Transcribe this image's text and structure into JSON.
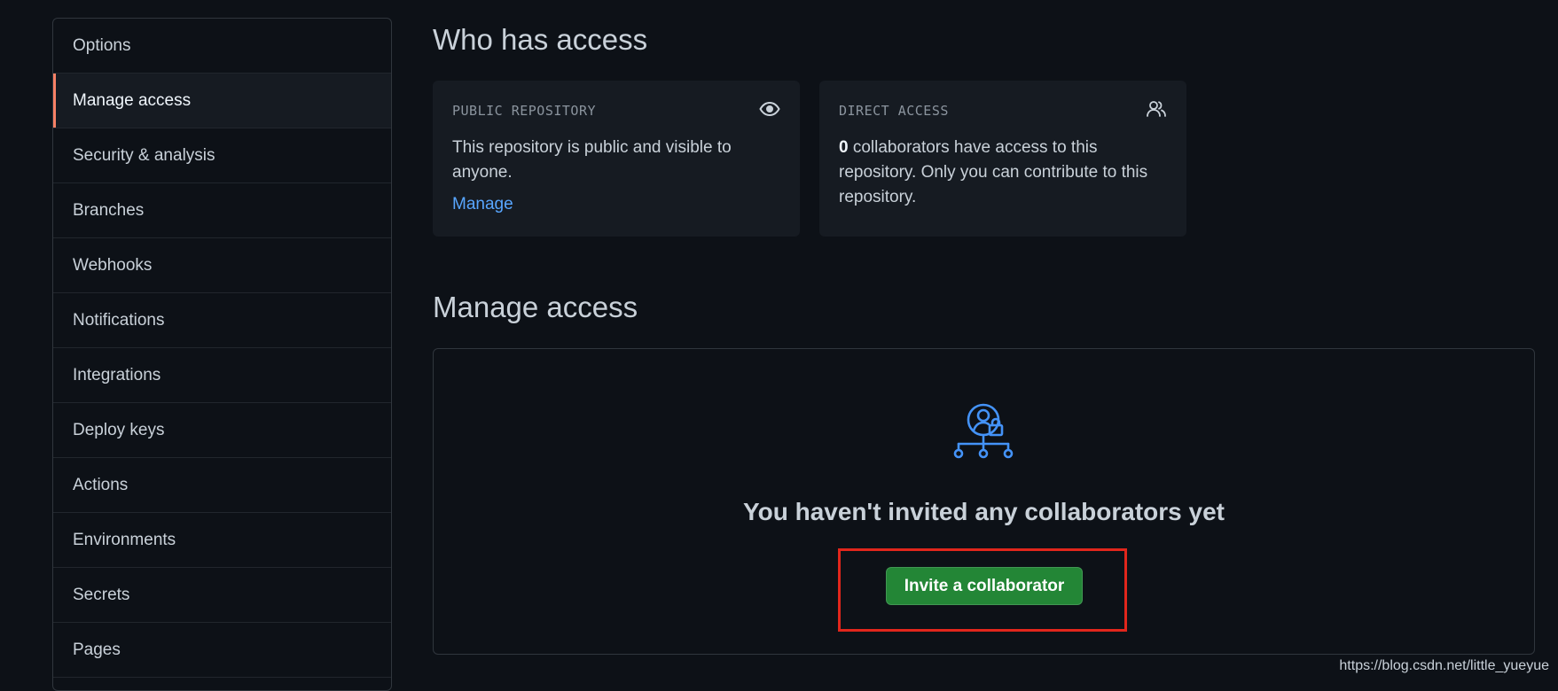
{
  "sidebar": {
    "items": [
      {
        "label": "Options"
      },
      {
        "label": "Manage access"
      },
      {
        "label": "Security & analysis"
      },
      {
        "label": "Branches"
      },
      {
        "label": "Webhooks"
      },
      {
        "label": "Notifications"
      },
      {
        "label": "Integrations"
      },
      {
        "label": "Deploy keys"
      },
      {
        "label": "Actions"
      },
      {
        "label": "Environments"
      },
      {
        "label": "Secrets"
      },
      {
        "label": "Pages"
      }
    ],
    "selected": "Manage access"
  },
  "who_has_access": {
    "title": "Who has access",
    "public_card": {
      "heading": "PUBLIC REPOSITORY",
      "icon": "eye-icon",
      "text": "This repository is public and visible to anyone.",
      "link": "Manage"
    },
    "direct_card": {
      "heading": "DIRECT ACCESS",
      "icon": "people-icon",
      "count": "0",
      "text": " collaborators have access to this repository. Only you can contribute to this repository."
    }
  },
  "manage_access": {
    "title": "Manage access",
    "empty_icon": "person-lock-network-icon",
    "empty_title": "You haven't invited any collaborators yet",
    "invite_button": "Invite a collaborator"
  },
  "watermark": "https://blog.csdn.net/little_yueyue",
  "colors": {
    "background": "#0d1117",
    "card": "#161b22",
    "border": "#30363d",
    "accent_selected": "#f78166",
    "link": "#58a6ff",
    "button": "#238636",
    "icon_blue": "#4493f8",
    "highlight": "#e1261c"
  }
}
